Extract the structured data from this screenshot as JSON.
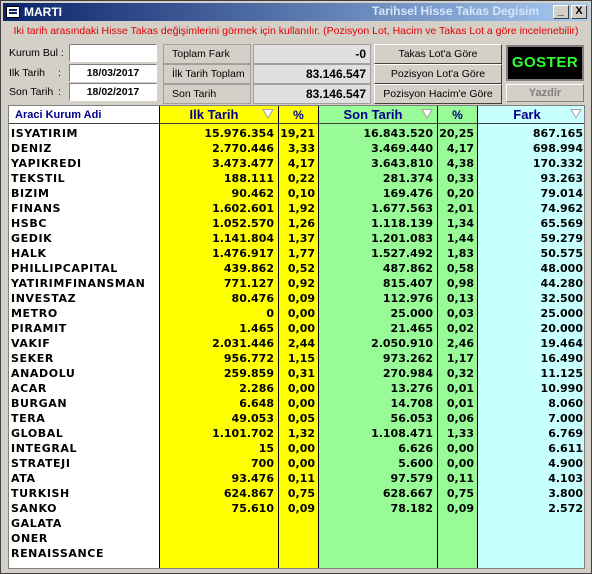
{
  "window": {
    "title": "MARTI",
    "subtitle": "Tarihsel Hisse Takas Degisim",
    "minimize": "_",
    "close": "X"
  },
  "hint": "Iki tarih arasındaki Hisse Takas değişimlerini görmek için kullanılır. (Pozisyon Lot, Hacim ve Takas Lot a göre incelenebilir)",
  "filters": {
    "kurum_bul_label": "Kurum Bul :",
    "kurum_bul_value": "",
    "ilk_tarih_label": "Ilk Tarih",
    "ilk_tarih_sep": ":",
    "ilk_tarih_value": "18/03/2017",
    "son_tarih_label": "Son Tarih",
    "son_tarih_sep": ":",
    "son_tarih_value": "18/02/2017"
  },
  "summary": {
    "toplam_fark_label": "Toplam Fark",
    "toplam_fark_value": "-0",
    "ilk_toplam_label": "İlk Tarih Toplam",
    "ilk_toplam_value": "83.146.547",
    "son_toplam_label": "Son Tarih Toplam",
    "son_toplam_value": "83.146.547"
  },
  "buttons": {
    "takas_lot": "Takas Lot'a Göre",
    "pozisyon_lot": "Pozisyon Lot'a Göre",
    "pozisyon_hacim": "Pozisyon Hacim'e Göre",
    "goster": "GOSTER",
    "yazdir": "Yazdir"
  },
  "columns": {
    "name": "Araci Kurum Adi",
    "ilk_tarih": "Ilk Tarih",
    "pct1": "%",
    "son_tarih": "Son Tarih",
    "pct2": "%",
    "fark": "Fark"
  },
  "colors": {
    "yellow": "#ffff00",
    "green": "#98fb98",
    "cyan": "#c8ffff"
  },
  "rows": [
    {
      "name": "ISYATIRIM",
      "ilk": "15.976.354",
      "p1": "19,21",
      "son": "16.843.520",
      "p2": "20,25",
      "fark": "867.165"
    },
    {
      "name": "DENIZ",
      "ilk": "2.770.446",
      "p1": "3,33",
      "son": "3.469.440",
      "p2": "4,17",
      "fark": "698.994"
    },
    {
      "name": "YAPIKREDI",
      "ilk": "3.473.477",
      "p1": "4,17",
      "son": "3.643.810",
      "p2": "4,38",
      "fark": "170.332"
    },
    {
      "name": "TEKSTIL",
      "ilk": "188.111",
      "p1": "0,22",
      "son": "281.374",
      "p2": "0,33",
      "fark": "93.263"
    },
    {
      "name": "BIZIM",
      "ilk": "90.462",
      "p1": "0,10",
      "son": "169.476",
      "p2": "0,20",
      "fark": "79.014"
    },
    {
      "name": "FINANS",
      "ilk": "1.602.601",
      "p1": "1,92",
      "son": "1.677.563",
      "p2": "2,01",
      "fark": "74.962"
    },
    {
      "name": "HSBC",
      "ilk": "1.052.570",
      "p1": "1,26",
      "son": "1.118.139",
      "p2": "1,34",
      "fark": "65.569"
    },
    {
      "name": "GEDIK",
      "ilk": "1.141.804",
      "p1": "1,37",
      "son": "1.201.083",
      "p2": "1,44",
      "fark": "59.279"
    },
    {
      "name": "HALK",
      "ilk": "1.476.917",
      "p1": "1,77",
      "son": "1.527.492",
      "p2": "1,83",
      "fark": "50.575"
    },
    {
      "name": "PHILLIPCAPITAL",
      "ilk": "439.862",
      "p1": "0,52",
      "son": "487.862",
      "p2": "0,58",
      "fark": "48.000"
    },
    {
      "name": "YATIRIMFINANSMAN",
      "ilk": "771.127",
      "p1": "0,92",
      "son": "815.407",
      "p2": "0,98",
      "fark": "44.280"
    },
    {
      "name": "INVESTAZ",
      "ilk": "80.476",
      "p1": "0,09",
      "son": "112.976",
      "p2": "0,13",
      "fark": "32.500"
    },
    {
      "name": "METRO",
      "ilk": "0",
      "p1": "0,00",
      "son": "25.000",
      "p2": "0,03",
      "fark": "25.000"
    },
    {
      "name": "PIRAMIT",
      "ilk": "1.465",
      "p1": "0,00",
      "son": "21.465",
      "p2": "0,02",
      "fark": "20.000"
    },
    {
      "name": "VAKIF",
      "ilk": "2.031.446",
      "p1": "2,44",
      "son": "2.050.910",
      "p2": "2,46",
      "fark": "19.464"
    },
    {
      "name": "SEKER",
      "ilk": "956.772",
      "p1": "1,15",
      "son": "973.262",
      "p2": "1,17",
      "fark": "16.490"
    },
    {
      "name": "ANADOLU",
      "ilk": "259.859",
      "p1": "0,31",
      "son": "270.984",
      "p2": "0,32",
      "fark": "11.125"
    },
    {
      "name": "ACAR",
      "ilk": "2.286",
      "p1": "0,00",
      "son": "13.276",
      "p2": "0,01",
      "fark": "10.990"
    },
    {
      "name": "BURGAN",
      "ilk": "6.648",
      "p1": "0,00",
      "son": "14.708",
      "p2": "0,01",
      "fark": "8.060"
    },
    {
      "name": "TERA",
      "ilk": "49.053",
      "p1": "0,05",
      "son": "56.053",
      "p2": "0,06",
      "fark": "7.000"
    },
    {
      "name": "GLOBAL",
      "ilk": "1.101.702",
      "p1": "1,32",
      "son": "1.108.471",
      "p2": "1,33",
      "fark": "6.769"
    },
    {
      "name": "INTEGRAL",
      "ilk": "15",
      "p1": "0,00",
      "son": "6.626",
      "p2": "0,00",
      "fark": "6.611"
    },
    {
      "name": "STRATEJI",
      "ilk": "700",
      "p1": "0,00",
      "son": "5.600",
      "p2": "0,00",
      "fark": "4.900"
    },
    {
      "name": "ATA",
      "ilk": "93.476",
      "p1": "0,11",
      "son": "97.579",
      "p2": "0,11",
      "fark": "4.103"
    },
    {
      "name": "TURKISH",
      "ilk": "624.867",
      "p1": "0,75",
      "son": "628.667",
      "p2": "0,75",
      "fark": "3.800"
    },
    {
      "name": "SANKO",
      "ilk": "75.610",
      "p1": "0,09",
      "son": "78.182",
      "p2": "0,09",
      "fark": "2.572"
    },
    {
      "name": "GALATA",
      "ilk": "",
      "p1": "",
      "son": "",
      "p2": "",
      "fark": ""
    },
    {
      "name": "ONER",
      "ilk": "",
      "p1": "",
      "son": "",
      "p2": "",
      "fark": ""
    },
    {
      "name": "RENAISSANCE",
      "ilk": "",
      "p1": "",
      "son": "",
      "p2": "",
      "fark": ""
    }
  ]
}
